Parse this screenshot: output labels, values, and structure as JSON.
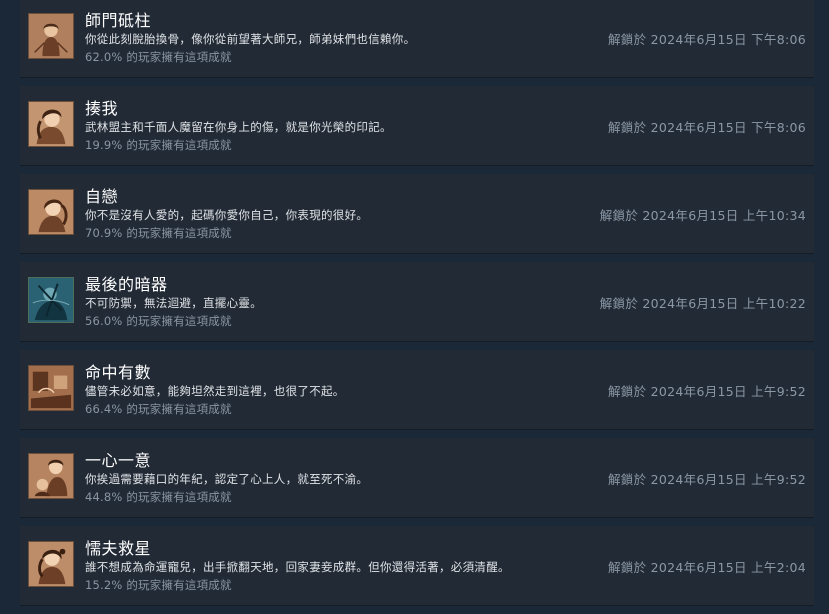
{
  "achievements": [
    {
      "title": "師門砥柱",
      "description": "你從此刻脫胎換骨，像你從前望著大師兄，師弟妹們也信賴你。",
      "percent": "62.0% 的玩家擁有這項成就",
      "unlocked": "解鎖於 2024年6月15日 下午8:06",
      "icon": "sepia-portrait-icon"
    },
    {
      "title": "揍我",
      "description": "武林盟主和千面人魔留在你身上的傷，就是你光榮的印記。",
      "percent": "19.9% 的玩家擁有這項成就",
      "unlocked": "解鎖於 2024年6月15日 下午8:06",
      "icon": "sepia-portrait-icon"
    },
    {
      "title": "自戀",
      "description": "你不是沒有人愛的，起碼你愛你自己，你表現的很好。",
      "percent": "70.9% 的玩家擁有這項成就",
      "unlocked": "解鎖於 2024年6月15日 上午10:34",
      "icon": "sepia-portrait-icon"
    },
    {
      "title": "最後的暗器",
      "description": "不可防禦，無法迴避，直擺心靈。",
      "percent": "56.0% 的玩家擁有這項成就",
      "unlocked": "解鎖於 2024年6月15日 上午10:22",
      "icon": "blue-portrait-icon"
    },
    {
      "title": "命中有數",
      "description": "儘管未必如意，能夠坦然走到這裡，也很了不起。",
      "percent": "66.4% 的玩家擁有這項成就",
      "unlocked": "解鎖於 2024年6月15日 上午9:52",
      "icon": "sepia-scene-icon"
    },
    {
      "title": "一心一意",
      "description": "你挨過需要藉口的年紀，認定了心上人，就至死不渝。",
      "percent": "44.8% 的玩家擁有這項成就",
      "unlocked": "解鎖於 2024年6月15日 上午9:52",
      "icon": "sepia-couple-icon"
    },
    {
      "title": "懦夫救星",
      "description": "誰不想成為命運寵兒，出手掀翻天地，回家妻妾成群。但你還得活著，必須清醒。",
      "percent": "15.2% 的玩家擁有這項成就",
      "unlocked": "解鎖於 2024年6月15日 上午2:04",
      "icon": "sepia-portrait-icon"
    }
  ],
  "colors": {
    "background": "#1b2838",
    "row": "#222a36",
    "sepia": "#8a5a3c",
    "blue_icon": "#2b5f73"
  }
}
